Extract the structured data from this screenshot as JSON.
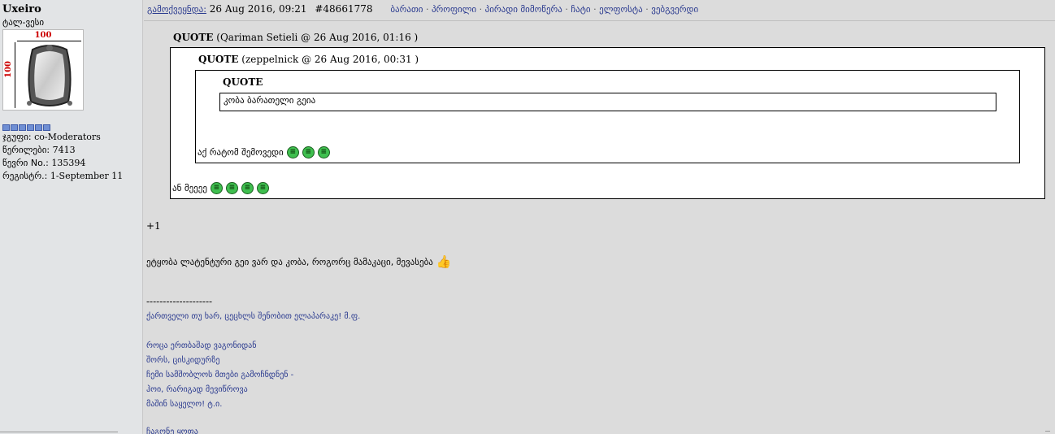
{
  "user": {
    "name": "Uxeiro",
    "title": "ტალ-ვესი",
    "avatar": {
      "dim_w": "100",
      "dim_h": "100",
      "icon": "mirror-frame-avatar"
    },
    "rank_pips": 6,
    "stats": [
      {
        "label": "ჯგუფი:",
        "value": "co-Moderators"
      },
      {
        "label": "წერილები:",
        "value": "7413"
      },
      {
        "label": "წევრი No.:",
        "value": "135394"
      },
      {
        "label": "რეგისტრ.:",
        "value": "1-September 11"
      }
    ]
  },
  "post": {
    "posted_label": "გამოქვეყნდა:",
    "date": "26 Aug 2016, 09:21",
    "id": "#48661778",
    "links": [
      "ბარათი",
      "პროფილი",
      "პირადი მიმოწერა",
      "ჩატი",
      "ელფოსტა",
      "ვებგვერდი"
    ],
    "link_sep": "·"
  },
  "quotes": {
    "outer": {
      "label": "QUOTE",
      "meta": "(Qariman Setieli @ 26 Aug 2016, 01:16 )",
      "reply": "ან მეეეე"
    },
    "middle": {
      "label": "QUOTE",
      "meta": "(zeppelnick @ 26 Aug 2016, 00:31 )",
      "reply": "აქ რატომ შემოვედი"
    },
    "inner": {
      "label": "QUOTE",
      "text": "კობა ბარათელი გეია"
    },
    "smiley_icon": "laughing-smiley-icon"
  },
  "body": {
    "plus_one": "+1",
    "line": "ეტყობა ლატენტური გეი ვარ და კობა, როგორც მამაკაცი, მევასება",
    "thumb_icon": "thumbs-up-icon"
  },
  "signature": {
    "divider": "--------------------",
    "lines": [
      "ქართველი თუ ხარ, ცეცხლს შენობით ელაპარაკე! მ.ფ.",
      "",
      "როცა ერთბაშად ვაგონიდან",
      "შორს, ცისკიდურზე",
      "ჩემი სამშობლოს მთები გამოჩნდნენ -",
      "ჰოი, რარიგად მევიწროვა",
      "მაშინ საყელო! ტ.ი."
    ],
    "partial": "ჩაგონე ყოფა"
  }
}
